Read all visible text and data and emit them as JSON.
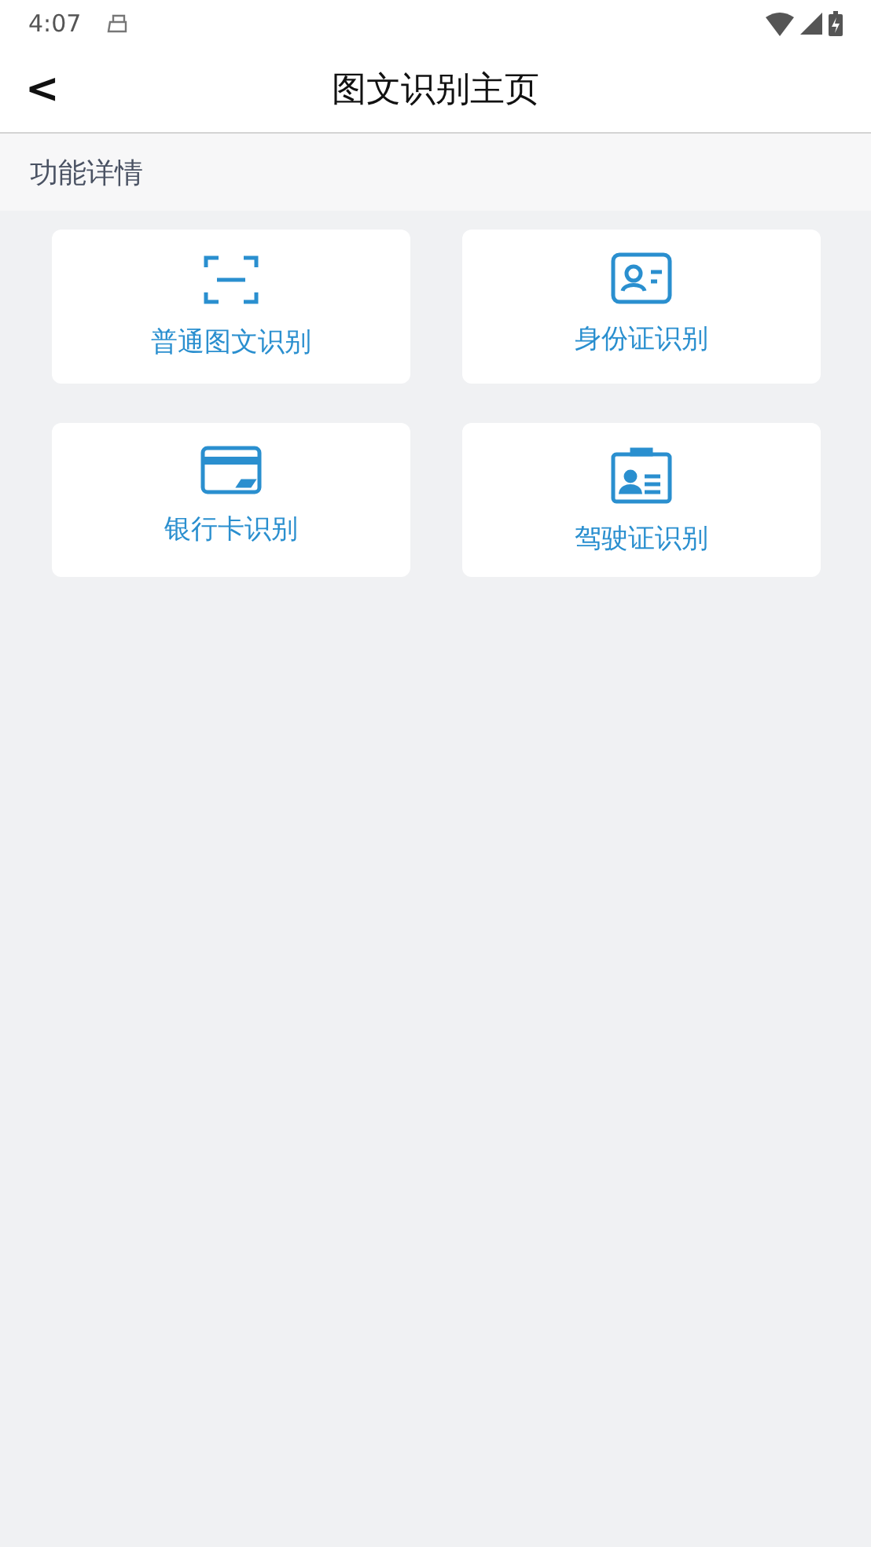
{
  "status_bar": {
    "time": "4:07"
  },
  "header": {
    "back": "<",
    "title": "图文识别主页"
  },
  "section": {
    "title": "功能详情"
  },
  "features": [
    {
      "kind": "scan",
      "label": "普通图文识别"
    },
    {
      "kind": "idcard",
      "label": "身份证识别"
    },
    {
      "kind": "bankcard",
      "label": "银行卡识别"
    },
    {
      "kind": "license",
      "label": "驾驶证识别"
    }
  ]
}
